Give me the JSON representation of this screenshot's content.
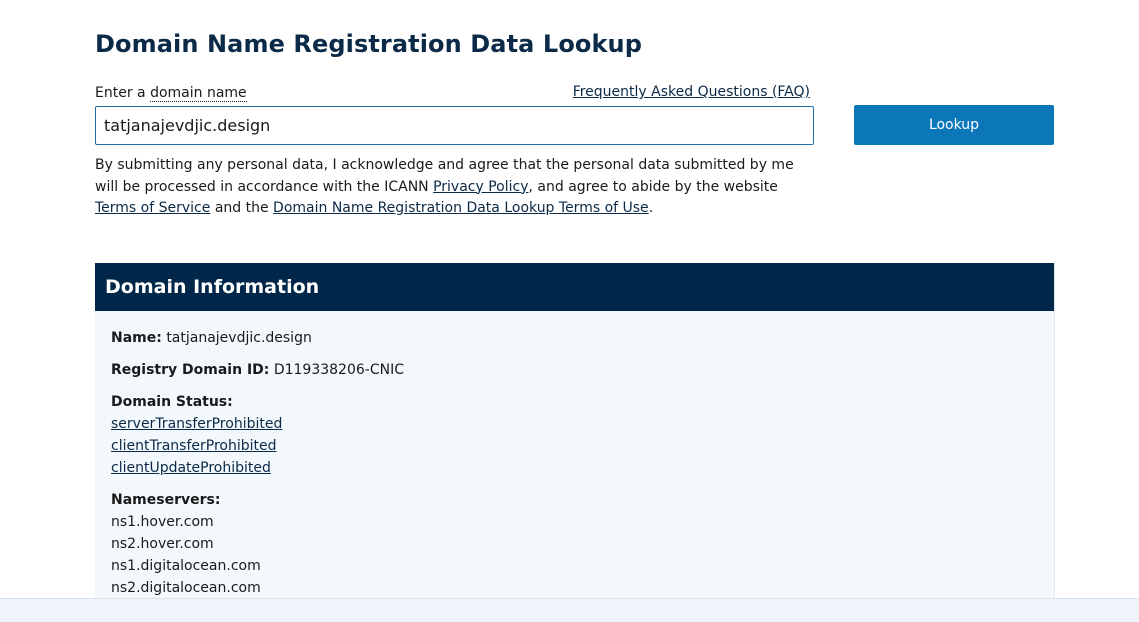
{
  "page": {
    "title": "Domain Name Registration Data Lookup"
  },
  "search": {
    "label_prefix": "Enter a ",
    "label_term": "domain name",
    "faq_link": "Frequently Asked Questions (FAQ)",
    "value": "tatjanajevdjic.design",
    "button_label": "Lookup"
  },
  "disclaimer": {
    "text_1": "By submitting any personal data, I acknowledge and agree that the personal data submitted by me will be processed in accordance with the ICANN ",
    "privacy_link": "Privacy Policy",
    "text_2": ", and agree to abide by the website ",
    "terms_link": "Terms of Service",
    "text_3": " and the ",
    "terms_of_use_link": "Domain Name Registration Data Lookup Terms of Use",
    "text_4": "."
  },
  "domain_info": {
    "header": "Domain Information",
    "name_label": "Name:",
    "name_value": "tatjanajevdjic.design",
    "registry_id_label": "Registry Domain ID:",
    "registry_id_value": "D119338206-CNIC",
    "status_label": "Domain Status:",
    "statuses": [
      "serverTransferProhibited",
      "clientTransferProhibited",
      "clientUpdateProhibited"
    ],
    "nameservers_label": "Nameservers:",
    "nameservers": [
      "ns1.hover.com",
      "ns2.hover.com",
      "ns1.digitalocean.com",
      "ns2.digitalocean.com"
    ]
  },
  "colors": {
    "title": "#0b2a47",
    "button": "#0b76b8",
    "header_bg": "#00274a",
    "panel_bg": "#f3f8fc"
  }
}
